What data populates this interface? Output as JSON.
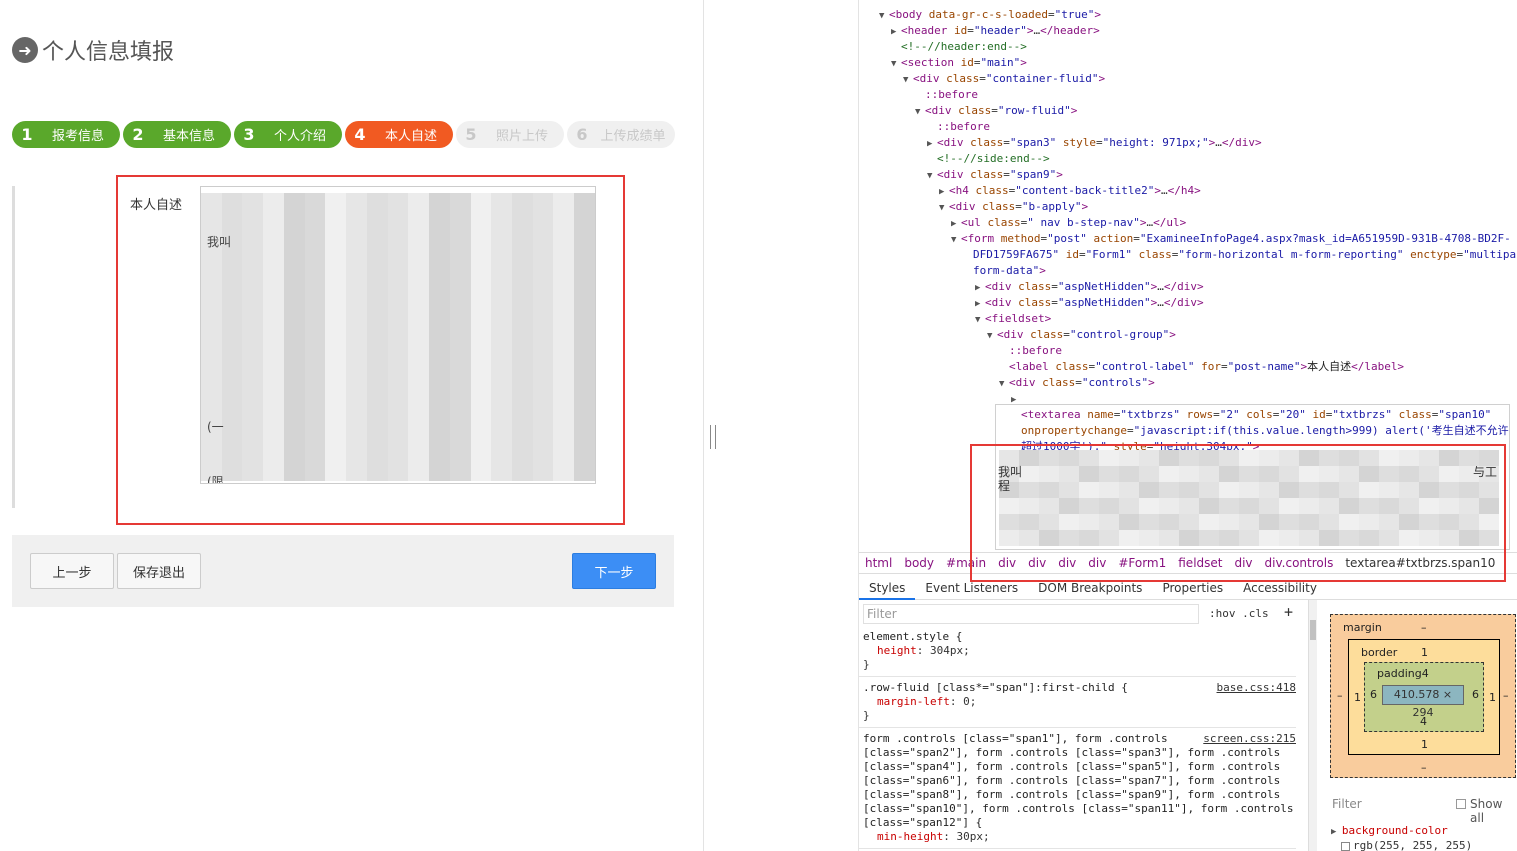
{
  "page": {
    "title": "个人信息填报",
    "steps": [
      {
        "num": "1",
        "label": "报考信息",
        "state": "done"
      },
      {
        "num": "2",
        "label": "基本信息",
        "state": "done"
      },
      {
        "num": "3",
        "label": "个人介绍",
        "state": "done"
      },
      {
        "num": "4",
        "label": "本人自述",
        "state": "active"
      },
      {
        "num": "5",
        "label": "照片上传",
        "state": "todo"
      },
      {
        "num": "6",
        "label": "上传成绩单",
        "state": "todo"
      }
    ],
    "field_label": "本人自述",
    "textarea_visible_fragments": [
      "我叫",
      "(一",
      "(限"
    ],
    "buttons": {
      "prev": "上一步",
      "save": "保存退出",
      "next": "下一步"
    },
    "colors": {
      "done": "#5aa82b",
      "active": "#f15a22",
      "next_button": "#3c8ef5",
      "highlight": "#e53935"
    }
  },
  "devtools": {
    "dom_lines": [
      {
        "indent": 1,
        "tri": "▼",
        "html": "<span class='tag'>&lt;body</span> <span class='attr'>data-gr-c-s-loaded</span>=<span class='val'>\"true\"</span><span class='tag'>&gt;</span>"
      },
      {
        "indent": 2,
        "tri": "▶",
        "html": "<span class='tag'>&lt;header</span> <span class='attr'>id</span>=<span class='val'>\"header\"</span><span class='tag'>&gt;</span>…<span class='tag'>&lt;/header&gt;</span>"
      },
      {
        "indent": 2,
        "tri": "",
        "html": "<span class='cm'>&lt;!--//header:end--&gt;</span>"
      },
      {
        "indent": 2,
        "tri": "▼",
        "html": "<span class='tag'>&lt;section</span> <span class='attr'>id</span>=<span class='val'>\"main\"</span><span class='tag'>&gt;</span>"
      },
      {
        "indent": 3,
        "tri": "▼",
        "html": "<span class='tag'>&lt;div</span> <span class='attr'>class</span>=<span class='val'>\"container-fluid\"</span><span class='tag'>&gt;</span>"
      },
      {
        "indent": 4,
        "tri": "",
        "html": "<span class='ps'>::before</span>"
      },
      {
        "indent": 4,
        "tri": "▼",
        "html": "<span class='tag'>&lt;div</span> <span class='attr'>class</span>=<span class='val'>\"row-fluid\"</span><span class='tag'>&gt;</span>"
      },
      {
        "indent": 5,
        "tri": "",
        "html": "<span class='ps'>::before</span>"
      },
      {
        "indent": 5,
        "tri": "▶",
        "html": "<span class='tag'>&lt;div</span> <span class='attr'>class</span>=<span class='val'>\"span3\"</span> <span class='attr'>style</span>=<span class='val'>\"height: 971px;\"</span><span class='tag'>&gt;</span>…<span class='tag'>&lt;/div&gt;</span>"
      },
      {
        "indent": 5,
        "tri": "",
        "html": "<span class='cm'>&lt;!--//side:end--&gt;</span>"
      },
      {
        "indent": 5,
        "tri": "▼",
        "html": "<span class='tag'>&lt;div</span> <span class='attr'>class</span>=<span class='val'>\"span9\"</span><span class='tag'>&gt;</span>"
      },
      {
        "indent": 6,
        "tri": "▶",
        "html": "<span class='tag'>&lt;h4</span> <span class='attr'>class</span>=<span class='val'>\"content-back-title2\"</span><span class='tag'>&gt;</span>…<span class='tag'>&lt;/h4&gt;</span>"
      },
      {
        "indent": 6,
        "tri": "▼",
        "html": "<span class='tag'>&lt;div</span> <span class='attr'>class</span>=<span class='val'>\"b-apply\"</span><span class='tag'>&gt;</span>"
      },
      {
        "indent": 7,
        "tri": "▶",
        "html": "<span class='tag'>&lt;ul</span> <span class='attr'>class</span>=<span class='val'>\" nav b-step-nav\"</span><span class='tag'>&gt;</span>…<span class='tag'>&lt;/ul&gt;</span>"
      },
      {
        "indent": 7,
        "tri": "▼",
        "html": "<span class='tag'>&lt;form</span> <span class='attr'>method</span>=<span class='val'>\"post\"</span> <span class='attr'>action</span>=<span class='val'>\"ExamineeInfoPage4.aspx?mask_id=A651959D-931B-4708-BD2F-</span>"
      },
      {
        "indent": 8,
        "tri": "",
        "html": "<span class='val'>DFD1759FA675\"</span> <span class='attr'>id</span>=<span class='val'>\"Form1\"</span> <span class='attr'>class</span>=<span class='val'>\"form-horizontal m-form-reporting\"</span> <span class='attr'>enctype</span>=<span class='val'>\"multipart/</span>"
      },
      {
        "indent": 8,
        "tri": "",
        "html": "<span class='val'>form-data\"</span><span class='tag'>&gt;</span>"
      },
      {
        "indent": 9,
        "tri": "▶",
        "html": "<span class='tag'>&lt;div</span> <span class='attr'>class</span>=<span class='val'>\"aspNetHidden\"</span><span class='tag'>&gt;</span>…<span class='tag'>&lt;/div&gt;</span>"
      },
      {
        "indent": 9,
        "tri": "▶",
        "html": "<span class='tag'>&lt;div</span> <span class='attr'>class</span>=<span class='val'>\"aspNetHidden\"</span><span class='tag'>&gt;</span>…<span class='tag'>&lt;/div&gt;</span>"
      },
      {
        "indent": 9,
        "tri": "▼",
        "html": "<span class='tag'>&lt;fieldset&gt;</span>"
      },
      {
        "indent": 10,
        "tri": "▼",
        "html": "<span class='tag'>&lt;div</span> <span class='attr'>class</span>=<span class='val'>\"control-group\"</span><span class='tag'>&gt;</span>"
      },
      {
        "indent": 11,
        "tri": "",
        "html": "<span class='ps'>::before</span>"
      },
      {
        "indent": 11,
        "tri": "",
        "html": "<span class='tag'>&lt;label</span> <span class='attr'>class</span>=<span class='val'>\"control-label\"</span> <span class='attr'>for</span>=<span class='val'>\"post-name\"</span><span class='tag'>&gt;</span><span class='dt'>本人自述</span><span class='tag'>&lt;/label&gt;</span>"
      },
      {
        "indent": 11,
        "tri": "▼",
        "html": "<span class='tag'>&lt;div</span> <span class='attr'>class</span>=<span class='val'>\"controls\"</span><span class='tag'>&gt;</span>"
      },
      {
        "indent": 12,
        "tri": "▶",
        "html": ""
      },
      {
        "indent": 12,
        "tri": "",
        "html": "<span class='tag'>&lt;textarea</span> <span class='attr'>name</span>=<span class='val'>\"txtbrzs\"</span> <span class='attr'>rows</span>=<span class='val'>\"2\"</span> <span class='attr'>cols</span>=<span class='val'>\"20\"</span> <span class='attr'>id</span>=<span class='val'>\"txtbrzs\"</span> <span class='attr'>class</span>=<span class='val'>\"span10\"</span>"
      },
      {
        "indent": 12,
        "tri": "",
        "html": "<span class='attr'>onpropertychange</span>=<span class='val'>\"javascript:if(this.value.length&gt;999) alert('考生自述不允许</span>"
      },
      {
        "indent": 12,
        "tri": "",
        "html": "<span class='val'>超过1000字');\"</span> <span class='attr'>style</span>=<span class='val'>\"height:304px;\"</span><span class='tag'>&gt;</span>"
      }
    ],
    "dom_fragments": [
      "我叫",
      "与工",
      "程"
    ],
    "breadcrumbs": [
      "html",
      "body",
      "#main",
      "div",
      "div",
      "div",
      "div",
      "#Form1",
      "fieldset",
      "div",
      "div.controls",
      "textarea#txtbrzs.span10"
    ],
    "tabs": [
      "Styles",
      "Event Listeners",
      "DOM Breakpoints",
      "Properties",
      "Accessibility"
    ],
    "filter_placeholder": "Filter",
    "hov_cls": ":hov  .cls",
    "rules": [
      {
        "selector": "element.style {",
        "props": [
          "height: 304px;"
        ],
        "source": ""
      },
      {
        "selector": ".row-fluid [class*=\"span\"]:first-child {",
        "props": [
          "margin-left: 0;"
        ],
        "source": "base.css:418"
      },
      {
        "selector_lines": [
          "form .controls [class=\"span1\"], form .controls",
          "[class=\"span2\"], form .controls [class=\"span3\"], form .controls",
          "[class=\"span4\"], form .controls [class=\"span5\"], form .controls",
          "[class=\"span6\"], form .controls [class=\"span7\"], form .controls",
          "[class=\"span8\"], form .controls [class=\"span9\"], form .controls",
          "[class=\"span10\"], form .controls [class=\"span11\"], form .controls",
          "[class=\"span12\"] {"
        ],
        "props": [
          "min-height: 30px;"
        ],
        "source": "screen.css:215"
      }
    ],
    "box_model": {
      "margin_label": "margin",
      "margin_top": "–",
      "margin_bottom": "–",
      "margin_left": "–",
      "margin_right": "–",
      "border_label": "border",
      "border_top": "1",
      "border_bottom": "1",
      "border_left": "1",
      "border_right": "1",
      "padding_label": "padding4",
      "padding_bottom": "4",
      "padding_left": "6",
      "padding_right": "6",
      "content": "410.578 × 294"
    },
    "computed_filter": "Filter",
    "show_all": "Show all",
    "computed_prop": "background-color",
    "computed_val": "rgb(255, 255, 255)"
  }
}
